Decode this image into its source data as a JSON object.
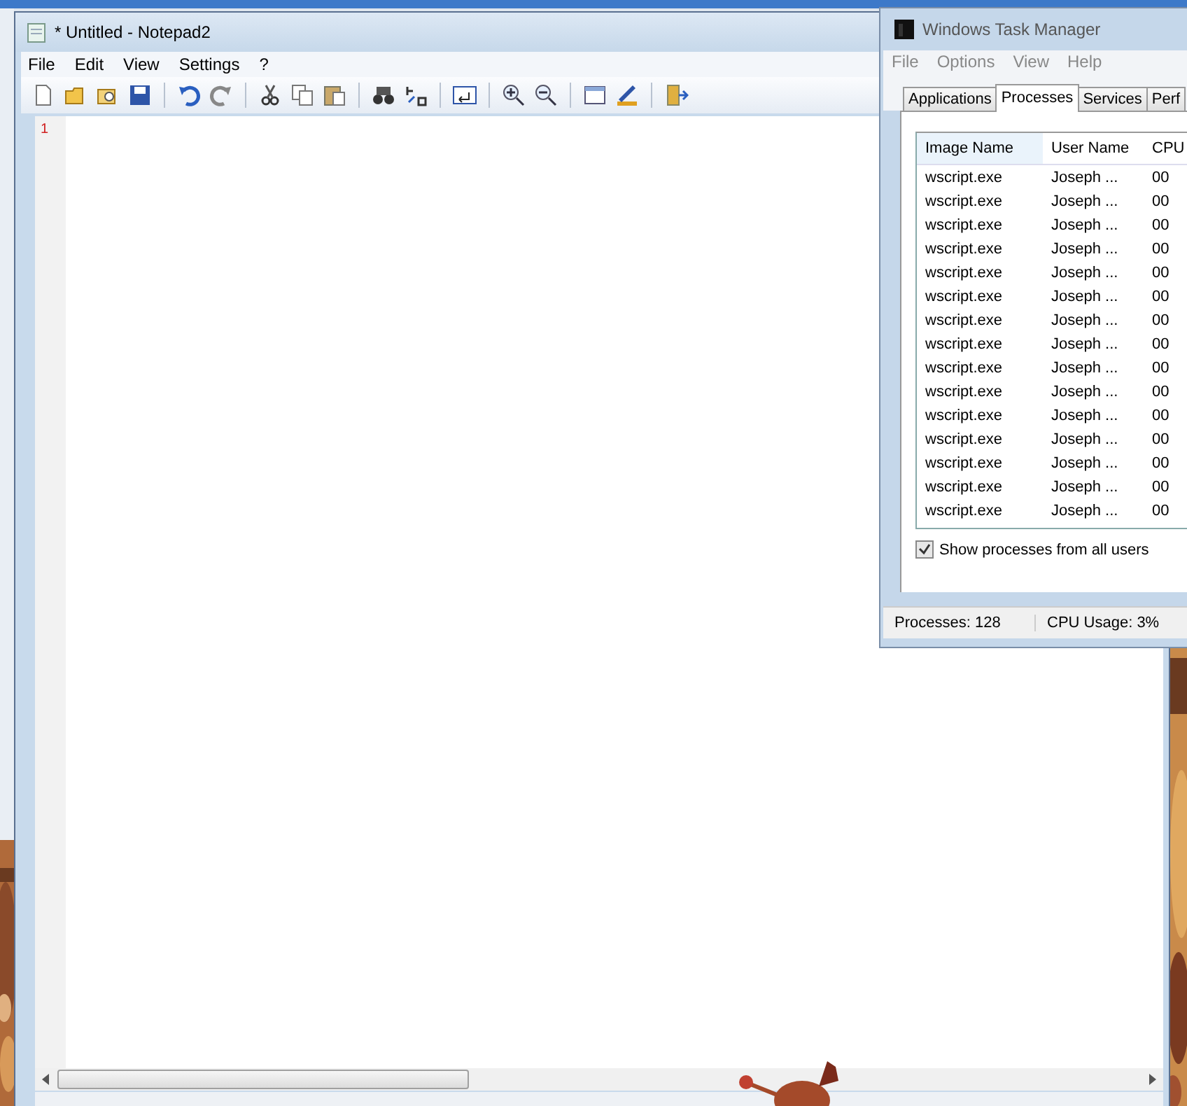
{
  "notepad": {
    "title": "* Untitled - Notepad2",
    "menu": [
      "File",
      "Edit",
      "View",
      "Settings",
      "?"
    ],
    "line_numbers": [
      "1"
    ]
  },
  "task_manager": {
    "title": "Windows Task Manager",
    "menu": [
      "File",
      "Options",
      "View",
      "Help"
    ],
    "tabs": [
      {
        "label": "Applications",
        "selected": false
      },
      {
        "label": "Processes",
        "selected": true
      },
      {
        "label": "Services",
        "selected": false
      },
      {
        "label": "Perf",
        "selected": false
      }
    ],
    "columns": [
      "Image Name",
      "User Name",
      "CPU"
    ],
    "rows": [
      {
        "image_name": "wscript.exe",
        "user_name": "Joseph ...",
        "cpu": "00"
      },
      {
        "image_name": "wscript.exe",
        "user_name": "Joseph ...",
        "cpu": "00"
      },
      {
        "image_name": "wscript.exe",
        "user_name": "Joseph ...",
        "cpu": "00"
      },
      {
        "image_name": "wscript.exe",
        "user_name": "Joseph ...",
        "cpu": "00"
      },
      {
        "image_name": "wscript.exe",
        "user_name": "Joseph ...",
        "cpu": "00"
      },
      {
        "image_name": "wscript.exe",
        "user_name": "Joseph ...",
        "cpu": "00"
      },
      {
        "image_name": "wscript.exe",
        "user_name": "Joseph ...",
        "cpu": "00"
      },
      {
        "image_name": "wscript.exe",
        "user_name": "Joseph ...",
        "cpu": "00"
      },
      {
        "image_name": "wscript.exe",
        "user_name": "Joseph ...",
        "cpu": "00"
      },
      {
        "image_name": "wscript.exe",
        "user_name": "Joseph ...",
        "cpu": "00"
      },
      {
        "image_name": "wscript.exe",
        "user_name": "Joseph ...",
        "cpu": "00"
      },
      {
        "image_name": "wscript.exe",
        "user_name": "Joseph ...",
        "cpu": "00"
      },
      {
        "image_name": "wscript.exe",
        "user_name": "Joseph ...",
        "cpu": "00"
      },
      {
        "image_name": "wscript.exe",
        "user_name": "Joseph ...",
        "cpu": "00"
      },
      {
        "image_name": "wscript.exe",
        "user_name": "Joseph ...",
        "cpu": "00"
      }
    ],
    "show_all_users": {
      "label": "Show processes from all users",
      "checked": true
    },
    "status": [
      "Processes: 128",
      "CPU Usage: 3%"
    ]
  }
}
